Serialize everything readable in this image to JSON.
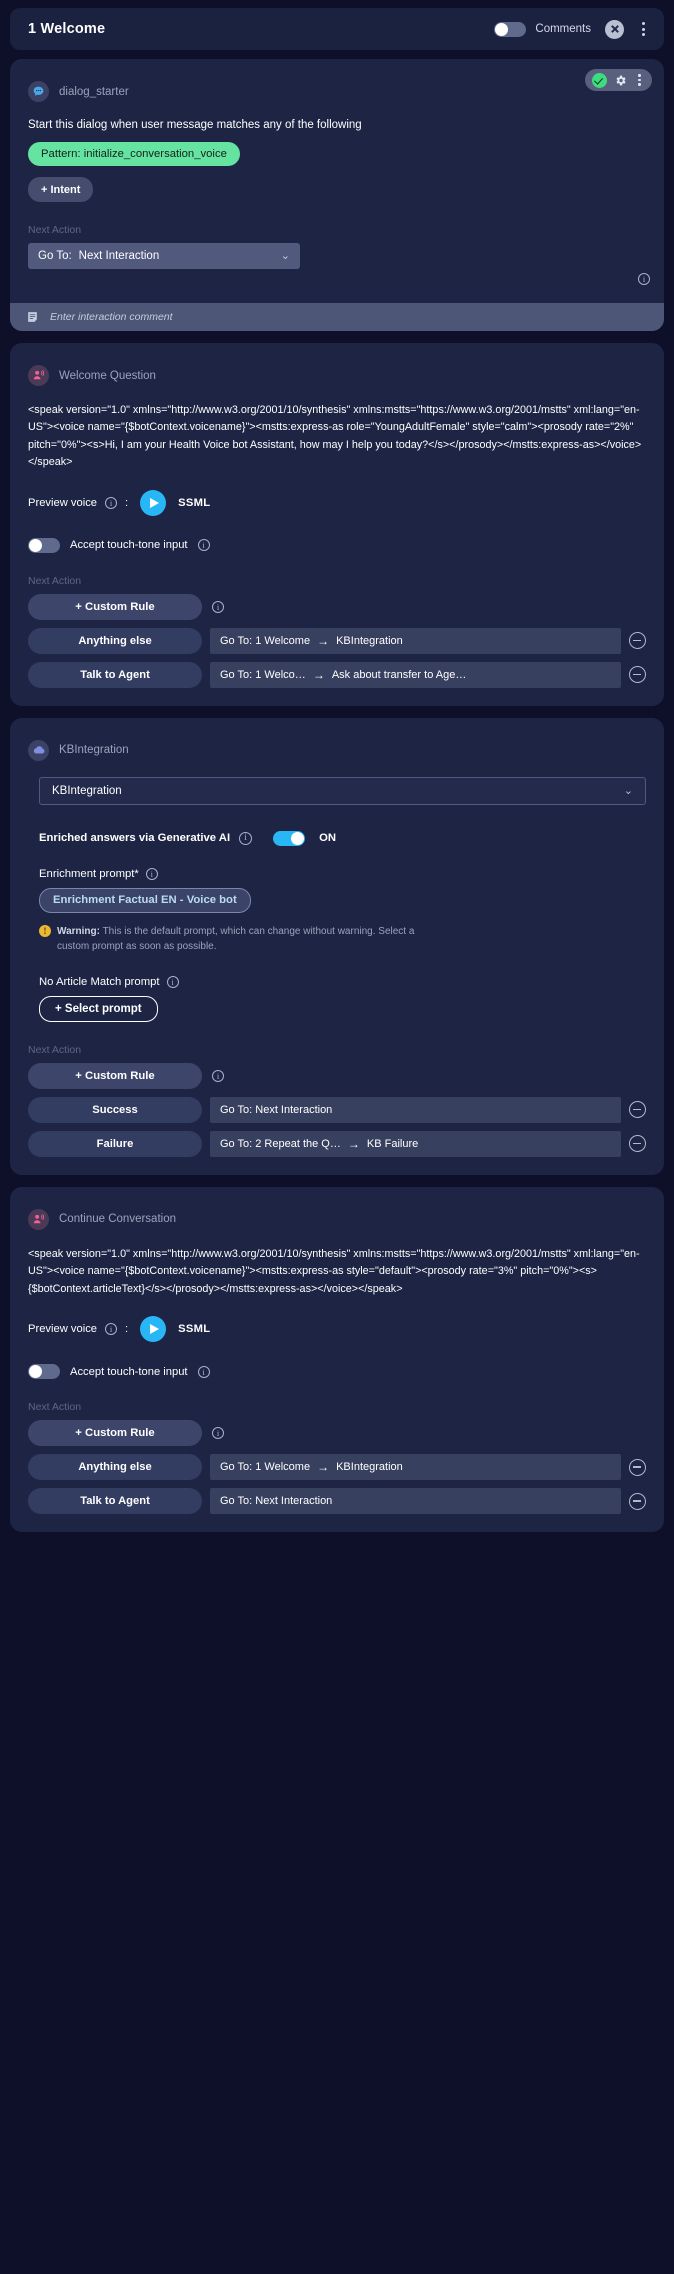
{
  "header": {
    "title": "1 Welcome",
    "comments_label": "Comments",
    "comments_toggle": "off",
    "close_icon": "close-circle-icon",
    "menu_icon": "kebab-menu-icon"
  },
  "cards": {
    "dialog_starter": {
      "node_title": "dialog_starter",
      "avatar_icon": "chat-bubble-icon",
      "actions": {
        "status": "valid-check",
        "settings": "gear-icon",
        "menu": "kebab-menu-icon"
      },
      "description": "Start this dialog when user message matches any of the following",
      "pattern_pill": "Pattern:  initialize_conversation_voice",
      "add_intent_label": "+ Intent",
      "next_action_label": "Next Action",
      "goto_prefix": "Go To:",
      "goto_value": "Next Interaction",
      "comment_placeholder": "Enter interaction comment",
      "comment_icon": "comment-note-icon",
      "info_icon": "info-icon"
    },
    "welcome_question": {
      "node_title": "Welcome Question",
      "avatar_icon": "voice-prompt-icon",
      "ssml": "<speak version=\"1.0\" xmlns=\"http://www.w3.org/2001/10/synthesis\" xmlns:mstts=\"https://www.w3.org/2001/mstts\" xml:lang=\"en-US\"><voice name=\"{$botContext.voicename}\"><mstts:express-as role=\"YoungAdultFemale\" style=\"calm\"><prosody rate=\"2%\" pitch=\"0%\"><s>Hi, I am your Health Voice bot Assistant, how may I help you today?</s></prosody></mstts:express-as></voice></speak>",
      "preview_label": "Preview voice",
      "preview_colon": ":",
      "play_icon": "play-icon",
      "ssml_tag": "SSML",
      "touchtone_label": "Accept touch-tone input",
      "touchtone_toggle": "off",
      "next_action_label": "Next Action",
      "custom_rule_label": "+ Custom Rule",
      "rules": [
        {
          "name": "Anything else",
          "goto_prefix": "Go To: 1 Welcome",
          "arrow": "→",
          "target": "KBIntegration"
        },
        {
          "name": "Talk to Agent",
          "goto_prefix": "Go To: 1 Welco…",
          "arrow": "→",
          "target": "Ask about transfer to Age…"
        }
      ]
    },
    "kb_integration": {
      "node_title": "KBIntegration",
      "avatar_icon": "cloud-icon",
      "select_value": "KBIntegration",
      "generative_label": "Enriched answers via Generative AI",
      "generative_toggle": "on",
      "generative_state": "ON",
      "enrichment_label": "Enrichment prompt*",
      "enrichment_pill": "Enrichment Factual EN - Voice bot",
      "warning_title": "Warning:",
      "warning_text": "This is the default prompt, which can change without warning. Select a custom prompt as soon as possible.",
      "no_article_label": "No Article Match prompt",
      "select_prompt_label": "+ Select prompt",
      "next_action_label": "Next Action",
      "custom_rule_label": "+ Custom Rule",
      "rules": [
        {
          "name": "Success",
          "goto_prefix": "Go To:  Next Interaction",
          "arrow": "",
          "target": ""
        },
        {
          "name": "Failure",
          "goto_prefix": "Go To: 2 Repeat the Q…",
          "arrow": "→",
          "target": "KB Failure"
        }
      ]
    },
    "continue_conversation": {
      "node_title": "Continue Conversation",
      "avatar_icon": "voice-prompt-icon",
      "ssml": "<speak version=\"1.0\" xmlns=\"http://www.w3.org/2001/10/synthesis\" xmlns:mstts=\"https://www.w3.org/2001/mstts\" xml:lang=\"en-US\"><voice name=\"{$botContext.voicename}\"><mstts:express-as style=\"default\"><prosody rate=\"3%\" pitch=\"0%\"><s>{$botContext.articleText}</s></prosody></mstts:express-as></voice></speak>",
      "preview_label": "Preview voice",
      "preview_colon": ":",
      "play_icon": "play-icon",
      "ssml_tag": "SSML",
      "touchtone_label": "Accept touch-tone input",
      "touchtone_toggle": "off",
      "next_action_label": "Next Action",
      "custom_rule_label": "+ Custom Rule",
      "rules": [
        {
          "name": "Anything else",
          "goto_prefix": "Go To: 1 Welcome",
          "arrow": "→",
          "target": "KBIntegration"
        },
        {
          "name": "Talk to Agent",
          "goto_prefix": "Go To:  Next Interaction",
          "arrow": "",
          "target": ""
        }
      ]
    }
  },
  "colors": {
    "accent_blue": "#29b6f6",
    "success_green": "#64e3a1",
    "warning_yellow": "#e8b931",
    "page_bg": "#0d1028",
    "card_bg": "#1e2544"
  }
}
